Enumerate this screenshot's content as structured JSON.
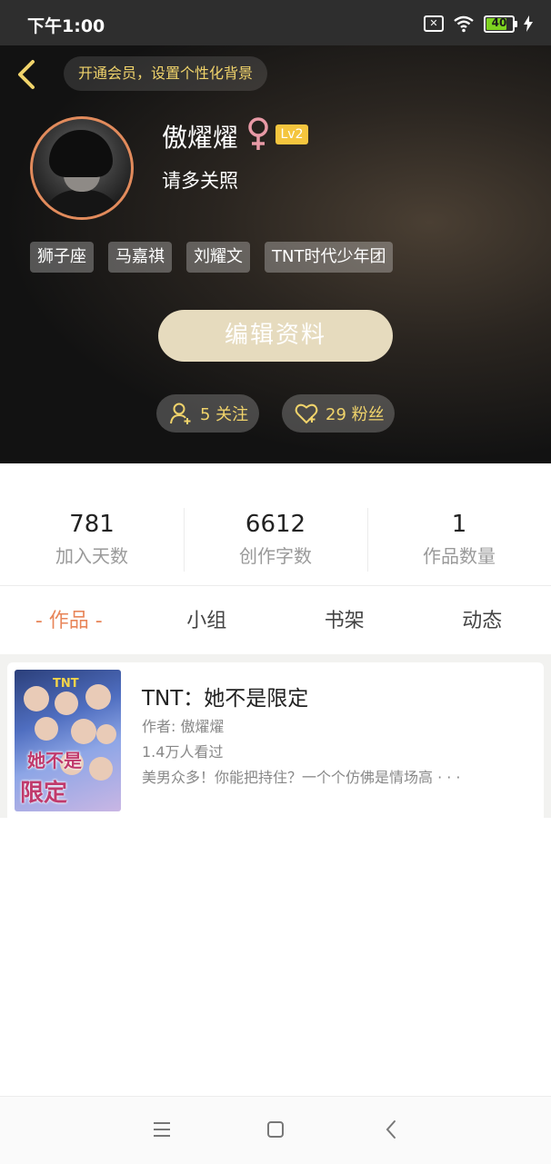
{
  "status_bar": {
    "time": "下午1:00",
    "sim_label": "✕",
    "battery": "40"
  },
  "header": {
    "vip_banner": "开通会员，设置个性化背景",
    "username": "傲燿燿",
    "level": "Lv2",
    "bio": "请多关照",
    "tags": [
      "狮子座",
      "马嘉祺",
      "刘耀文",
      "TNT时代少年团"
    ],
    "edit_button": "编辑资料",
    "follow_label": "5 关注",
    "fans_label": "29 粉丝",
    "colors": {
      "accent_gold": "#f0d36b",
      "avatar_ring": "#e28b5c",
      "level_badge": "#f4c53e"
    }
  },
  "stats": [
    {
      "value": "781",
      "label": "加入天数"
    },
    {
      "value": "6612",
      "label": "创作字数"
    },
    {
      "value": "1",
      "label": "作品数量"
    }
  ],
  "tabs": [
    "- 作品 -",
    "小组",
    "书架",
    "动态"
  ],
  "books": [
    {
      "title": "TNT：她不是限定",
      "author": "作者: 傲燿燿",
      "views": "1.4万人看过",
      "description": "美男众多！你能把持住？一个个仿佛是情场高 · · ·",
      "cover_logo": "TNT",
      "cover_text_top": "她不是",
      "cover_text_bottom": "限定"
    }
  ],
  "nav_icons": [
    "menu-icon",
    "home-square-icon",
    "back-chevron-icon"
  ]
}
